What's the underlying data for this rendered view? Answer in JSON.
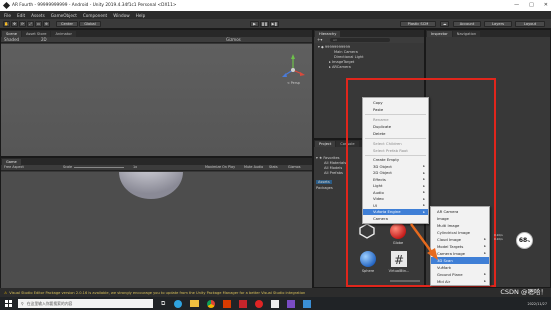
{
  "window": {
    "title": "AR Fourth - 99999999999 - Android - Unity 2019.4.34f1c1 Personal <DX11>",
    "controls": [
      "—",
      "□",
      "✕"
    ]
  },
  "menu": [
    "File",
    "Edit",
    "Assets",
    "GameObject",
    "Component",
    "Window",
    "Help"
  ],
  "toolbar": {
    "center": "Center",
    "local": "Global",
    "plastic": "Plastic SCM",
    "account": "Account",
    "layers": "Layers",
    "layout": "Layout"
  },
  "scene": {
    "tabs": [
      "Scene",
      "Asset Store",
      "Animator"
    ],
    "shading": "Shaded",
    "gizmos": "Gizmos",
    "persp": "< Persp"
  },
  "game": {
    "tabs": [
      "Game"
    ],
    "aspect": "Free Aspect",
    "scale_label": "Scale",
    "scale_value": "1x",
    "maximize": "Maximize On Play",
    "mute": "Mute Audio",
    "stats": "Stats",
    "gizmos": "Gizmos"
  },
  "hierarchy": {
    "tab": "Hierarchy",
    "search_placeholder": "All",
    "root": "99999999999",
    "items": [
      "Main Camera",
      "Directional Light",
      "ImageTarget",
      "ARCamera"
    ]
  },
  "inspector": {
    "tabs": [
      "Inspector",
      "Navigation"
    ]
  },
  "project": {
    "tabs": [
      "Project",
      "Console"
    ],
    "favorites_label": "Favorites",
    "favorites": [
      "All Materials",
      "All Models",
      "All Prefabs"
    ],
    "assets_label": "Assets",
    "packages_label": "Packages",
    "assets": [
      {
        "name": "",
        "icon": "unity-icon"
      },
      {
        "name": "Globe",
        "icon": "red-sphere-icon"
      },
      {
        "name": "Sphere",
        "icon": "blue-sphere-icon"
      },
      {
        "name": "VirtualBtn...",
        "icon": "script-hash-icon"
      }
    ]
  },
  "context_menu": {
    "items": [
      {
        "label": "Copy",
        "enabled": true
      },
      {
        "label": "Paste",
        "enabled": true
      },
      {
        "label": "Rename",
        "enabled": false
      },
      {
        "label": "Duplicate",
        "enabled": true
      },
      {
        "label": "Delete",
        "enabled": true
      },
      {
        "label": "Select Children",
        "enabled": false
      },
      {
        "label": "Select Prefab Root",
        "enabled": false
      },
      {
        "label": "Create Empty",
        "enabled": true
      },
      {
        "label": "3D Object",
        "enabled": true,
        "submenu": true
      },
      {
        "label": "2D Object",
        "enabled": true,
        "submenu": true
      },
      {
        "label": "Effects",
        "enabled": true,
        "submenu": true
      },
      {
        "label": "Light",
        "enabled": true,
        "submenu": true
      },
      {
        "label": "Audio",
        "enabled": true,
        "submenu": true
      },
      {
        "label": "Video",
        "enabled": true,
        "submenu": true
      },
      {
        "label": "UI",
        "enabled": true,
        "submenu": true
      },
      {
        "label": "Vuforia Engine",
        "enabled": true,
        "submenu": true,
        "highlighted": true
      },
      {
        "label": "Camera",
        "enabled": true
      }
    ]
  },
  "vuforia_submenu": {
    "items": [
      {
        "label": "AR Camera"
      },
      {
        "label": "Image"
      },
      {
        "label": "Multi Image"
      },
      {
        "label": "Cylindrical Image"
      },
      {
        "label": "Cloud Image",
        "submenu": true
      },
      {
        "label": "Model Targets",
        "submenu": true
      },
      {
        "label": "Camera Image",
        "submenu": true
      },
      {
        "label": "3D Scan",
        "highlighted": true
      },
      {
        "label": "VuMark"
      },
      {
        "label": "Ground Plane",
        "submenu": true
      },
      {
        "label": "Mid Air",
        "submenu": true
      }
    ]
  },
  "status": {
    "message": "Visual Studio Editor Package version 2.0.16 is available, we strongly encourage you to update from the Unity Package Manager for a better Visual Studio integration"
  },
  "overlay": {
    "net_speed_top": "0.1K/s",
    "net_speed_bottom": "0.1K/s",
    "percent": "68",
    "percent_unit": "%"
  },
  "taskbar": {
    "search_placeholder": "在这里输入你要搜索的内容",
    "watermark": "CSDN @嗯哈！",
    "time": "",
    "date": "2022/11/27"
  },
  "colors": {
    "highlight": "#3f7fd6",
    "annotation_red": "#e0261c",
    "annotation_arrow": "#e66a1e"
  }
}
